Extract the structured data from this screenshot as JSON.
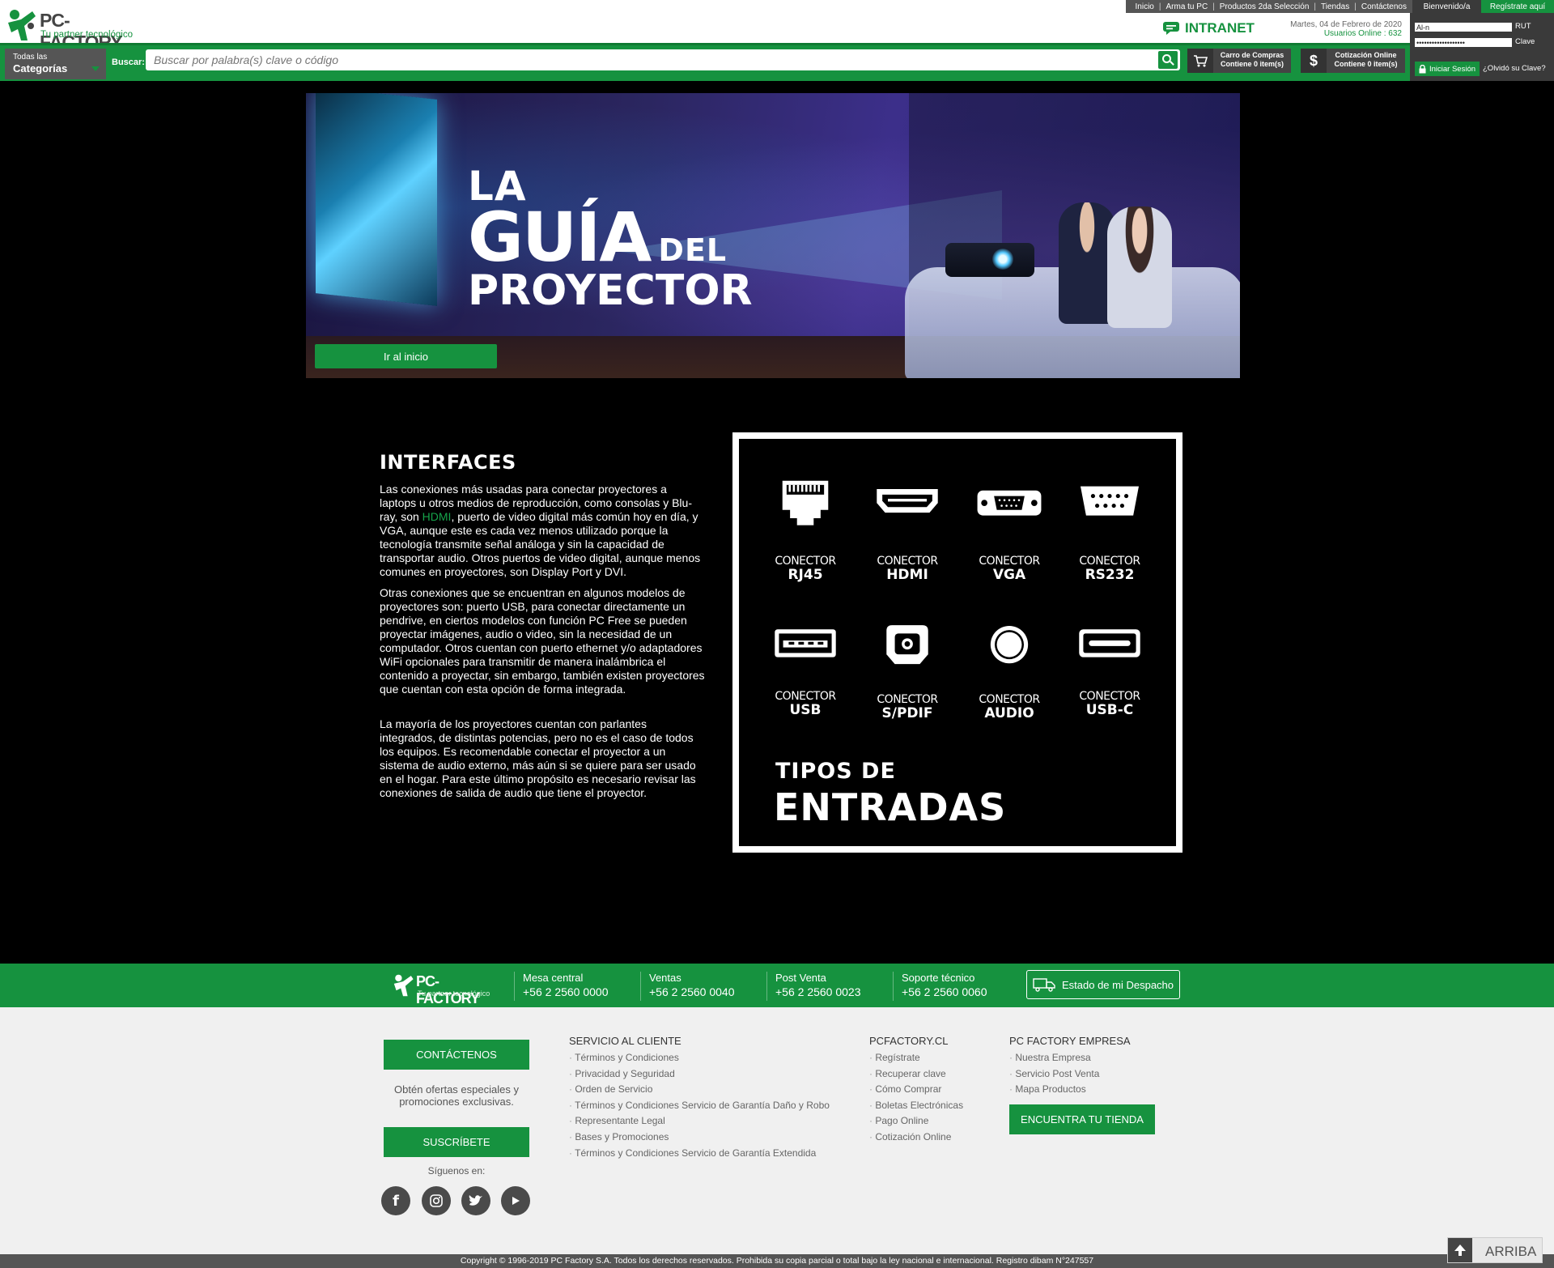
{
  "header": {
    "top_links": [
      "Inicio",
      "Arma tu PC",
      "Productos 2da Selección",
      "Tiendas",
      "Contáctenos"
    ],
    "welcome": "Bienvenido/a",
    "register": "Regístrate aquí",
    "brand": "PC-FACTORY",
    "tagline": "Tu partner tecnológico",
    "intranet": "INTRANET",
    "date": "Martes, 04 de Febrero de 2020",
    "online_users": "Usuarios Online : 632",
    "rut_value": "Al-n",
    "rut_label": "RUT",
    "clave_value": "•••••••••••••••••••",
    "clave_label": "Clave",
    "login_button": "Iniciar Sesión",
    "forgot": "¿Olvidó su Clave?",
    "categories_l1": "Todas las",
    "categories_l2": "Categorías",
    "search_label": "Buscar:",
    "search_placeholder": "Buscar por palabra(s) clave o código",
    "cart_t1": "Carro de Compras",
    "cart_t2": "Contiene 0 item(s)",
    "quote_t1": "Cotización Online",
    "quote_t2": "Contiene 0 item(s)"
  },
  "banner": {
    "title_l1": "LA",
    "title_l2": "GUÍA",
    "title_l2b": "DEL",
    "title_l3": "PROYECTOR",
    "home_button": "Ir al inicio"
  },
  "interfaces": {
    "title": "INTERFACES",
    "p1_a": "Las conexiones más usadas para conectar proyectores a laptops u otros medios de reproducción, como consolas y Blu-ray, son ",
    "p1_hl": "HDMI",
    "p1_b": ", puerto de video digital más común hoy en día, y VGA, aunque este es cada vez menos utilizado porque la tecnología transmite señal análoga y sin la capacidad de transportar audio. Otros puertos de video digital, aunque menos comunes en proyectores, son Display Port y DVI.",
    "p2": "Otras conexiones que se encuentran en algunos modelos de proyectores son: puerto USB, para conectar directamente un pendrive, en ciertos modelos con función PC Free se pueden proyectar imágenes, audio o video, sin la necesidad de un computador. Otros cuentan con puerto ethernet y/o adaptadores WiFi opcionales para transmitir de manera inalámbrica el contenido a proyectar, sin embargo, también existen proyectores que cuentan con esta opción de forma integrada.",
    "p3": "La mayoría de los proyectores cuentan con parlantes integrados, de distintas potencias, pero no es el caso de todos los equipos. Es recomendable conectar el proyector a un sistema de audio externo, más aún si se quiere para ser usado en el hogar. Para este último propósito es necesario revisar las conexiones de salida de audio que tiene el proyector."
  },
  "inputs": {
    "connector_word": "CONECTOR",
    "connectors": [
      {
        "name": "RJ45",
        "icon": "rj45-icon"
      },
      {
        "name": "HDMI",
        "icon": "hdmi-icon"
      },
      {
        "name": "VGA",
        "icon": "vga-icon"
      },
      {
        "name": "RS232",
        "icon": "rs232-icon"
      },
      {
        "name": "USB",
        "icon": "usb-icon"
      },
      {
        "name": "S/PDIF",
        "icon": "spdif-icon"
      },
      {
        "name": "AUDIO",
        "icon": "audio-jack-icon"
      },
      {
        "name": "USB-C",
        "icon": "usb-c-icon"
      }
    ],
    "tipos_l1": "TIPOS DE",
    "tipos_l2": "ENTRADAS"
  },
  "contact_bar": {
    "brand": "PC-FACTORY",
    "tagline": "Tu partner tecnológico",
    "phones": [
      {
        "label": "Mesa central",
        "number": "+56 2 2560 0000"
      },
      {
        "label": "Ventas",
        "number": "+56 2 2560 0040"
      },
      {
        "label": "Post Venta",
        "number": "+56 2 2560 0023"
      },
      {
        "label": "Soporte técnico",
        "number": "+56 2 2560 0060"
      }
    ],
    "despacho": "Estado de mi Despacho"
  },
  "footer": {
    "contact_button": "CONTÁCTENOS",
    "promo_text": "Obtén ofertas especiales y promociones exclusivas.",
    "subscribe_button": "SUSCRÍBETE",
    "follow": "Síguenos en:",
    "social": [
      "facebook-icon",
      "instagram-icon",
      "twitter-icon",
      "youtube-icon"
    ],
    "col1_title": "SERVICIO AL CLIENTE",
    "col1_items": [
      "Términos y Condiciones",
      "Privacidad y Seguridad",
      "Orden de Servicio",
      "Términos y Condiciones Servicio de Garantía Daño y Robo",
      "Representante Legal",
      "Bases y Promociones",
      "Términos y Condiciones Servicio de Garantía Extendida"
    ],
    "col2_title": "PCFACTORY.CL",
    "col2_items": [
      "Regístrate",
      "Recuperar clave",
      "Cómo Comprar",
      "Boletas Electrónicas",
      "Pago Online",
      "Cotización Online"
    ],
    "col3_title": "PC FACTORY EMPRESA",
    "col3_items": [
      "Nuestra Empresa",
      "Servicio Post Venta",
      "Mapa Productos"
    ],
    "store_button": "ENCUENTRA TU TIENDA",
    "copyright": "Copyright © 1996-2019 PC Factory S.A. Todos los derechos reservados. Prohibida su copia parcial o total bajo la ley nacional e internacional. Registro dibam N°247557",
    "arriba": "ARRIBA"
  },
  "colors": {
    "brand_green": "#16923f",
    "dark_gray": "#555555"
  }
}
